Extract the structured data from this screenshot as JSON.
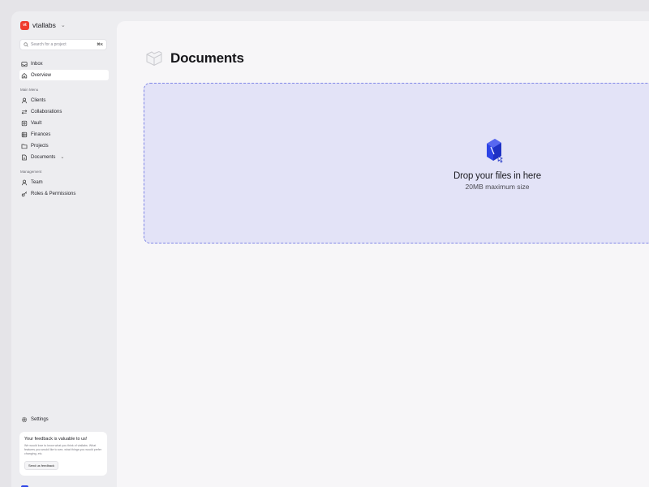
{
  "workspace": {
    "logo": "vt",
    "name": "vtallabs"
  },
  "search": {
    "placeholder": "Search for a project",
    "shortcut": "⌘K"
  },
  "nav_top": [
    {
      "label": "Inbox",
      "icon": "inbox-icon"
    },
    {
      "label": "Overview",
      "icon": "home-icon",
      "active": true
    }
  ],
  "sections": {
    "main_menu": "Main Menu",
    "management": "Management"
  },
  "main_menu": [
    {
      "label": "Clients",
      "icon": "user-icon"
    },
    {
      "label": "Collaborations",
      "icon": "arrows-icon"
    },
    {
      "label": "Vault",
      "icon": "vault-icon"
    },
    {
      "label": "Finances",
      "icon": "table-icon"
    },
    {
      "label": "Projects",
      "icon": "folder-icon"
    },
    {
      "label": "Documents",
      "icon": "document-icon"
    }
  ],
  "management": [
    {
      "label": "Team",
      "icon": "team-icon"
    },
    {
      "label": "Roles & Permissions",
      "icon": "key-icon"
    }
  ],
  "settings": {
    "label": "Settings",
    "icon": "gear-icon"
  },
  "feedback": {
    "title": "Your feedback is valuable to us!",
    "text": "We would love to know what you think of vtallabs. What features you would like to see, what things you would prefer changing, etc.",
    "button": "Send us feedback"
  },
  "page": {
    "title": "Documents"
  },
  "dropzone": {
    "title": "Drop your files in here",
    "subtitle": "20MB maximum size"
  },
  "colors": {
    "accent": "#2d44e6",
    "dropzone_bg": "#e3e3f7",
    "dropzone_border": "#7f86e6",
    "logo": "#ef3b2d"
  }
}
